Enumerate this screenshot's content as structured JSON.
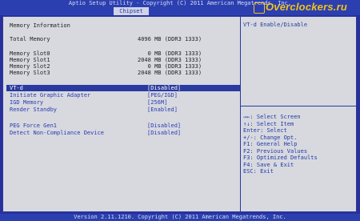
{
  "header": {
    "title": "Aptio Setup Utility - Copyright (C) 2011 American Megatrends, Inc.",
    "active_tab": "Chipset",
    "watermark": "Overclockers.ru"
  },
  "main": {
    "section_title": "Memory Information",
    "total_memory": {
      "label": "Total Memory",
      "value": "4096 MB (DDR3 1333)"
    },
    "slots": [
      {
        "label": "Memory Slot0",
        "value": "   0 MB (DDR3 1333)"
      },
      {
        "label": "Memory Slot1",
        "value": "2048 MB (DDR3 1333)"
      },
      {
        "label": "Memory Slot2",
        "value": "   0 MB (DDR3 1333)"
      },
      {
        "label": "Memory Slot3",
        "value": "2048 MB (DDR3 1333)"
      }
    ],
    "settings": [
      {
        "label": "VT-d",
        "value": "[Disabled]"
      },
      {
        "label": "Initiate Graphic Adapter",
        "value": "[PEG/IGD]"
      },
      {
        "label": "IGD Memory",
        "value": "[256M]"
      },
      {
        "label": "Render Standby",
        "value": "[Enabled]"
      },
      {
        "label": "PEG Force Gen1",
        "value": "[Disabled]"
      },
      {
        "label": "Detect Non-Compliance Device",
        "value": "[Disabled]"
      }
    ]
  },
  "help": {
    "description": "VT-d Enable/Disable",
    "keys": [
      "→←: Select Screen",
      "↑↓: Select Item",
      "Enter: Select",
      "+/-: Change Opt.",
      "F1: General Help",
      "F2: Previous Values",
      "F3: Optimized Defaults",
      "F4: Save & Exit",
      "ESC: Exit"
    ]
  },
  "footer": {
    "version": "Version 2.11.1210. Copyright (C) 2011 American Megatrends, Inc."
  },
  "colors": {
    "background": "#2a2f9a",
    "panel": "#d7d9df",
    "accent_blue": "#2a3ab0",
    "watermark": "#f2c21a"
  }
}
